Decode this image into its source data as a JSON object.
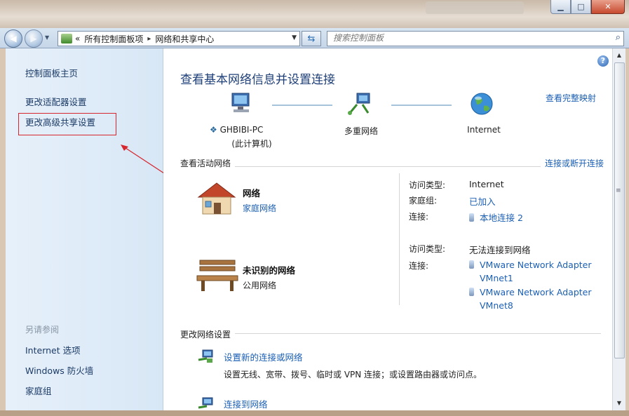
{
  "window": {
    "minimize_glyph": "▁",
    "maximize_glyph": "□",
    "close_glyph": "✕"
  },
  "address_bar": {
    "prefix": "«",
    "crumbs": [
      "所有控制面板项",
      "网络和共享中心"
    ],
    "separator": "▸"
  },
  "search": {
    "placeholder": "搜索控制面板"
  },
  "sidebar": {
    "home": "控制面板主页",
    "links": [
      "更改适配器设置",
      "更改高级共享设置"
    ],
    "see_also_heading": "另请参阅",
    "see_also": [
      "Internet 选项",
      "Windows 防火墙",
      "家庭组"
    ]
  },
  "main": {
    "title": "查看基本网络信息并设置连接",
    "full_map_link": "查看完整映射",
    "map": {
      "computer": {
        "name": "GHBIBI-PC",
        "sub": "(此计算机)"
      },
      "middle": "多重网络",
      "internet": "Internet"
    },
    "active_section": {
      "title": "查看活动网络",
      "action": "连接或断开连接"
    },
    "networks": [
      {
        "name": "网络",
        "type_link": "家庭网络",
        "props": [
          {
            "key": "访问类型:",
            "value": "Internet",
            "is_link": false
          },
          {
            "key": "家庭组:",
            "value": "已加入",
            "is_link": true
          },
          {
            "key": "连接:",
            "value": "本地连接 2",
            "is_link": true
          }
        ]
      },
      {
        "name": "未识别的网络",
        "type_text": "公用网络",
        "props": [
          {
            "key": "访问类型:",
            "value": "无法连接到网络",
            "is_link": false
          },
          {
            "key": "连接:",
            "value": "VMware Network Adapter",
            "value2": "VMnet1",
            "is_link": true
          },
          {
            "key": "",
            "value": "VMware Network Adapter",
            "value2": "VMnet8",
            "is_link": true
          }
        ]
      }
    ],
    "change_section": {
      "title": "更改网络设置"
    },
    "tasks": [
      {
        "label": "设置新的连接或网络",
        "desc": "设置无线、宽带、拨号、临时或 VPN 连接；或设置路由器或访问点。"
      },
      {
        "label": "连接到网络"
      }
    ]
  },
  "help_glyph": "?",
  "colors": {
    "link": "#1b5fb4",
    "title": "#1e3f78",
    "annotation": "#d6262e"
  }
}
